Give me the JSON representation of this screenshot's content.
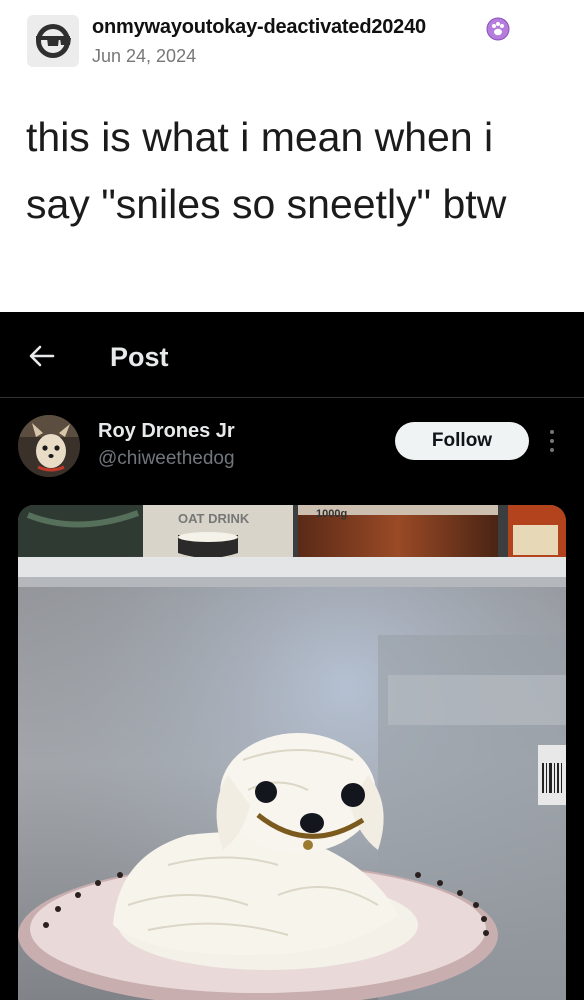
{
  "tumblr": {
    "username": "onmywayoutokay-deactivated20240",
    "date": "Jun 24, 2024",
    "caption": "this is what i mean when i say \"sniles so sneetly\" btw"
  },
  "x_post": {
    "header_title": "Post",
    "author_name": "Roy Drones Jr",
    "author_handle": "@chiweethedog",
    "follow_label": "Follow",
    "photo_labels": {
      "carton_text": "OAT DRINK",
      "jar_text": "1000g"
    }
  },
  "colors": {
    "x_background": "#000000",
    "x_text": "#e7e9ea",
    "x_muted": "#71767b",
    "follow_bg": "#eff3f4",
    "badge": "#b57edc"
  },
  "icons": [
    "glasses-avatar-icon",
    "paw-badge-icon",
    "back-arrow-icon",
    "more-dots-icon"
  ]
}
